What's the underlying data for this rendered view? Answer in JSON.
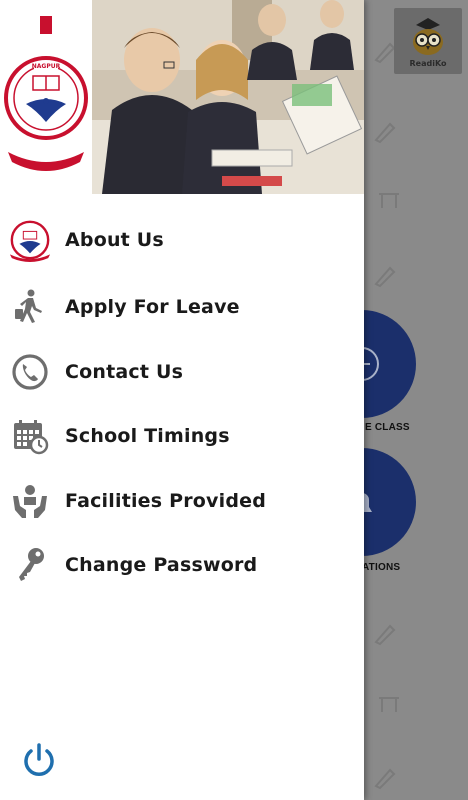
{
  "colors": {
    "drawer_bg": "#ffffff",
    "bg_overlay": "#8a8a8a",
    "circle_blue": "#1b2f6b",
    "label_text": "#1a1a1a",
    "icon_gray": "#6e6e6e",
    "power_blue": "#1f6fae",
    "logo_red": "#c8102e"
  },
  "header": {
    "logo": {
      "ring_text_top": "S.G.G.S EDUCATIONAL INSTITUTE",
      "ring_text_bottom": "NARSHANKAR TIBRA PARIVAR",
      "city": "NAGPUR"
    },
    "photo_icon": "classroom-photo"
  },
  "menu": {
    "items": [
      {
        "label": "About Us",
        "icon": "school-logo-icon"
      },
      {
        "label": "Apply For Leave",
        "icon": "walking-person-icon"
      },
      {
        "label": "Contact Us",
        "icon": "phone-icon"
      },
      {
        "label": "School Timings",
        "icon": "calendar-clock-icon"
      },
      {
        "label": "Facilities Provided",
        "icon": "hands-person-icon"
      },
      {
        "label": "Change Password",
        "icon": "key-icon"
      }
    ]
  },
  "power_icon": "power-icon",
  "background_app": {
    "brand_label": "ReadiKo",
    "labels": [
      {
        "text": "E CLASS"
      },
      {
        "text": "ATIONS"
      }
    ]
  }
}
